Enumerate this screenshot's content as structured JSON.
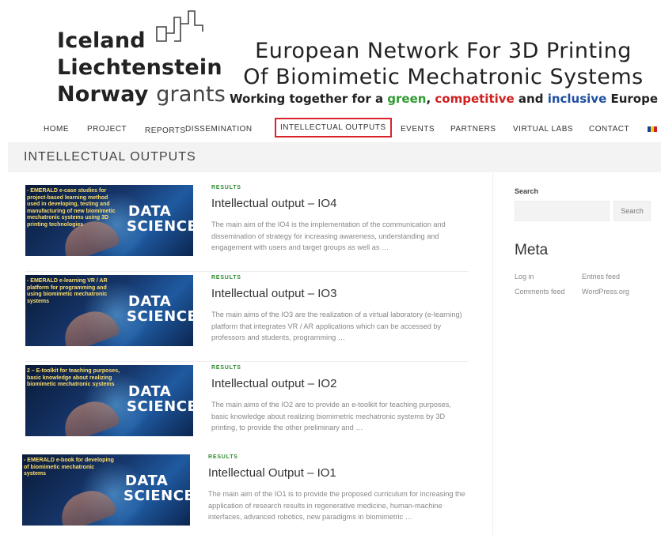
{
  "header": {
    "grants_logo": {
      "line1": "Iceland",
      "line2": "Liechtenstein",
      "line3_bold": "Norway",
      "line3_thin": "grants"
    },
    "site_title_line1": "European Network For 3D Printing",
    "site_title_line2": "Of Biomimetic Mechatronic Systems",
    "tagline": {
      "part1": "Working together for a ",
      "green": "green",
      "part2": ", ",
      "red": "competitive",
      "part3": " and ",
      "blue": "inclusive",
      "part4": " Europe"
    },
    "tagline_colors": {
      "green": "#2e9b2e",
      "red": "#d01f1f",
      "blue": "#1f4fa0"
    }
  },
  "nav": {
    "items": [
      {
        "label": "HOME"
      },
      {
        "label": "PROJECT"
      },
      {
        "label": "REPORTS"
      },
      {
        "label": "DISSEMINATION"
      },
      {
        "label": "INTELLECTUAL OUTPUTS",
        "highlighted": true
      },
      {
        "label": "EVENTS"
      },
      {
        "label": "PARTNERS"
      },
      {
        "label": "VIRTUAL LABS"
      },
      {
        "label": "CONTACT"
      }
    ],
    "language_flag": "romania-flag",
    "highlight_color": "#d8232a"
  },
  "page": {
    "title": "INTELLECTUAL OUTPUTS"
  },
  "posts": [
    {
      "category": "RESULTS",
      "title": "Intellectual output – IO4",
      "excerpt": "The main aim of the IO4 is the implementation of the communication and dissemination of strategy for increasing awareness, understanding and engagement with users and target groups as well as …",
      "thumb_caption": "- EMERALD e-case studies for project-based learning method used in developing, testing and manufacturing of new biomimetic mechatronic systems using 3D printing technologies",
      "thumb_title_1": "DATA",
      "thumb_title_2": "SCIENCE"
    },
    {
      "category": "RESULTS",
      "title": "Intellectual output – IO3",
      "excerpt": "The main aims of the IO3 are the realization of a virtual laboratory (e-learning) platform that integrates VR / AR applications which can be accessed by professors and students, programming …",
      "thumb_caption": "- EMERALD e-learning VR / AR platform for programming and using biomimetic mechatronic systems",
      "thumb_title_1": "DATA",
      "thumb_title_2": "SCIENCE"
    },
    {
      "category": "RESULTS",
      "title": "Intellectual output – IO2",
      "excerpt": "The main aims of the IO2 are to provide an e-toolkit for teaching purposes, basic knowledge about realizing biomimetric mechatronic systems by 3D printing, to provide the other preliminary and …",
      "thumb_caption": "2 – E-toolkit for teaching purposes, basic knowledge about realizing biomimetic mechatronic systems",
      "thumb_title_1": "DATA",
      "thumb_title_2": "SCIENCE"
    },
    {
      "category": "RESULTS",
      "title": "Intellectual Output – IO1",
      "excerpt": "The main aim of the IO1 is to provide the proposed curriculum for increasing the application of research results in regenerative medicine, human-machine interfaces, advanced robotics, new paradigms in biomimetric …",
      "thumb_caption": "- EMERALD e-book for developing of biomimetic mechatronic systems",
      "thumb_title_1": "DATA",
      "thumb_title_2": "SCIENCE"
    }
  ],
  "sidebar": {
    "search_label": "Search",
    "search_button": "Search",
    "search_placeholder": "",
    "meta_title": "Meta",
    "links": {
      "log_in": "Log in",
      "entries_feed": "Entries feed",
      "comments_feed": "Comments feed",
      "wordpress": "WordPress.org"
    }
  }
}
